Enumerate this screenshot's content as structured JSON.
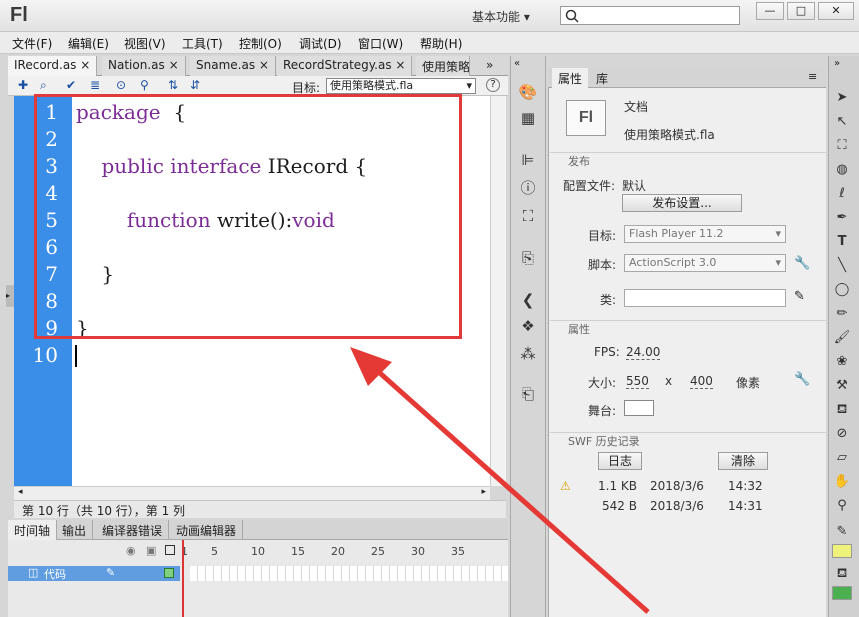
{
  "app": {
    "logo": "Fl",
    "workspace": "基本功能",
    "workspace_arrow": "▾"
  },
  "window_buttons": {
    "minimize": "—",
    "maximize": "□",
    "close": "✕"
  },
  "menu": [
    "文件(F)",
    "编辑(E)",
    "视图(V)",
    "工具(T)",
    "控制(O)",
    "调试(D)",
    "窗口(W)",
    "帮助(H)"
  ],
  "tabs": [
    "IRecord.as",
    "Nation.as",
    "Sname.as",
    "RecordStrategy.as",
    "使用策略"
  ],
  "tab_close": "×",
  "tab_overflow": "»",
  "editor": {
    "target_label": "目标:",
    "target_value": "使用策略模式.fla",
    "line_numbers": [
      "1",
      "2",
      "3",
      "4",
      "5",
      "6",
      "7",
      "8",
      "9",
      "10"
    ],
    "lines": [
      [
        {
          "t": "package",
          "k": 1
        },
        {
          "t": "  {",
          "k": 0
        }
      ],
      [],
      [
        {
          "t": "    ",
          "k": 0
        },
        {
          "t": "public interface",
          "k": 1
        },
        {
          "t": " IRecord {",
          "k": 0
        }
      ],
      [],
      [
        {
          "t": "        ",
          "k": 0
        },
        {
          "t": "function",
          "k": 1
        },
        {
          "t": " write():",
          "k": 0
        },
        {
          "t": "void",
          "k": 1
        }
      ],
      [],
      [
        {
          "t": "    }",
          "k": 0
        }
      ],
      [],
      [
        {
          "t": "}",
          "k": 0
        }
      ],
      []
    ]
  },
  "status": "第 10 行（共 10 行），第 1 列",
  "timeline": {
    "tabs": [
      "时间轴",
      "输出",
      "编译器错误",
      "动画编辑器"
    ],
    "frames": [
      "1",
      "5",
      "10",
      "15",
      "20",
      "25",
      "30",
      "35"
    ],
    "layer": "代码"
  },
  "properties": {
    "tabs": [
      "属性",
      "库"
    ],
    "doc_icon": "Fl",
    "doc_type": "文档",
    "doc_name": "使用策略模式.fla",
    "publish_section": "发布",
    "profile_label": "配置文件:",
    "profile_value": "默认",
    "publish_settings": "发布设置...",
    "target_label": "目标:",
    "target_value": "Flash Player 11.2",
    "script_label": "脚本:",
    "script_value": "ActionScript 3.0",
    "class_label": "类:",
    "props_section": "属性",
    "fps_label": "FPS:",
    "fps_value": "24.00",
    "size_label": "大小:",
    "width": "550",
    "x": "x",
    "height": "400",
    "unit": "像素",
    "stage_label": "舞台:",
    "stage_color": "#ffffff",
    "swf_section": "SWF 历史记录",
    "log_button": "日志",
    "clear_button": "清除",
    "history": [
      {
        "size": "1.1 KB",
        "date": "2018/3/6",
        "time": "14:32",
        "warn": true
      },
      {
        "size": "542 B",
        "date": "2018/3/6",
        "time": "14:31",
        "warn": false
      }
    ]
  },
  "colors": {
    "gutter": "#3b8ee8",
    "keyword": "#7b2c95",
    "highlight": "#e03a3a",
    "layer": "#5f9de0"
  }
}
